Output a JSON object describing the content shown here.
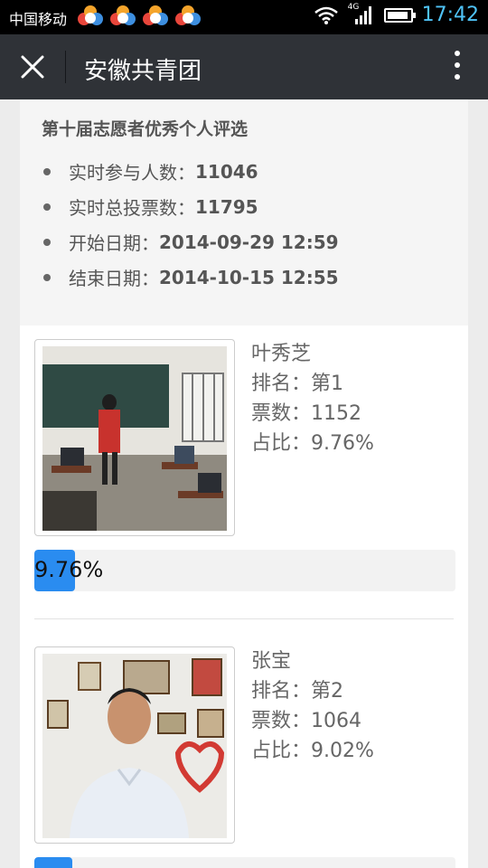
{
  "status_bar": {
    "carrier": "中国移动",
    "network_tag": "4G",
    "time": "17:42",
    "app_icons": [
      "app-icon",
      "app-icon",
      "app-icon",
      "app-icon"
    ]
  },
  "header": {
    "title": "安徽共青团",
    "close_icon": "close-icon",
    "more_icon": "more-vertical-icon"
  },
  "event": {
    "title": "第十届志愿者优秀个人评选",
    "stats": [
      {
        "label": "实时参与人数：",
        "value": "11046"
      },
      {
        "label": "实时总投票数：",
        "value": "11795"
      },
      {
        "label": "开始日期：",
        "value": "2014-09-29 12:59"
      },
      {
        "label": "结束日期：",
        "value": "2014-10-15 12:55"
      }
    ]
  },
  "candidates": [
    {
      "name": "叶秀芝",
      "rank": "排名：第1",
      "votes": "票数：1152",
      "share": "占比：9.76%",
      "progress_label": "9.76%",
      "progress_value": 9.76
    },
    {
      "name": "张宝",
      "rank": "排名：第2",
      "votes": "票数：1064",
      "share": "占比：9.02%",
      "progress_label": "",
      "progress_value": 9.02
    }
  ],
  "colors": {
    "accent": "#2a8cf0",
    "titlebar": "#2f3237",
    "clock": "#4fc3f7"
  }
}
